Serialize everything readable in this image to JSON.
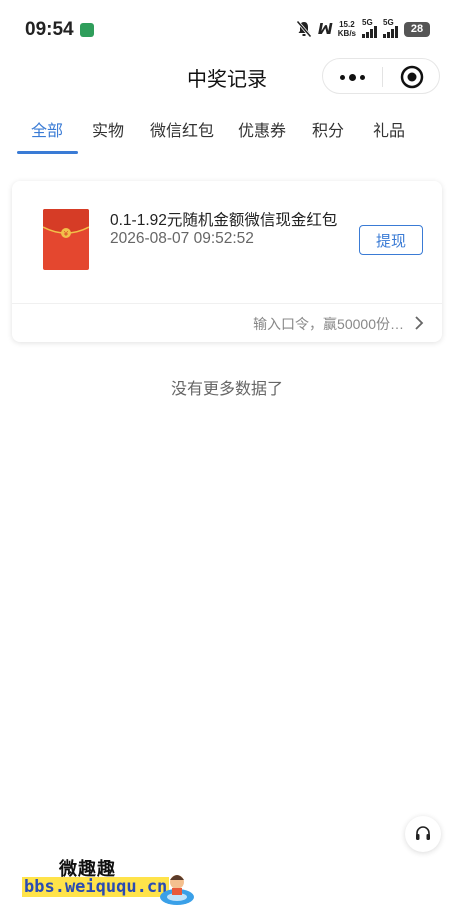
{
  "status_bar": {
    "time": "09:54",
    "net_speed_value": "15.2",
    "net_speed_unit": "KB/s",
    "signal1_label": "5G",
    "signal2_label": "5G",
    "battery": "28"
  },
  "header": {
    "title": "中奖记录"
  },
  "tabs": [
    {
      "label": "全部",
      "active": true
    },
    {
      "label": "实物",
      "active": false
    },
    {
      "label": "微信红包",
      "active": false
    },
    {
      "label": "优惠券",
      "active": false
    },
    {
      "label": "积分",
      "active": false
    },
    {
      "label": "礼品",
      "active": false
    }
  ],
  "records": [
    {
      "icon": "red-packet-icon",
      "name": "0.1-1.92元随机金额微信现金红包",
      "time": "2026-08-07 09:52:52",
      "action_label": "提现",
      "footer_text": "输入口令，赢50000份…"
    }
  ],
  "list_end_text": "没有更多数据了",
  "watermark": {
    "title": "微趣趣",
    "url": "bbs.weiququ.cn"
  },
  "colors": {
    "accent": "#3a7bd5",
    "red_packet": "#e4472f",
    "red_packet_gold": "#f2c04a"
  }
}
